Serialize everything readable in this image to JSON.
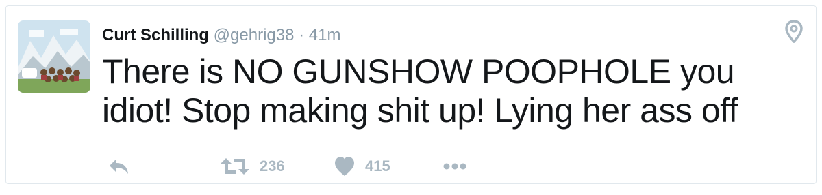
{
  "tweet": {
    "author_name": "Curt Schilling",
    "handle": "@gehrig38",
    "separator": "·",
    "time": "41m",
    "text": "There is NO GUNSHOW POOPHOLE you idiot! Stop making shit up! Lying her ass off"
  },
  "actions": {
    "reply_icon": "reply-icon",
    "retweet_icon": "retweet-icon",
    "retweet_count": "236",
    "like_icon": "heart-icon",
    "like_count": "415",
    "more_icon": "more-dots-icon"
  },
  "icons": {
    "location": "location-pin-icon"
  },
  "colors": {
    "text": "#14171a",
    "muted": "#8899a6",
    "action": "#aab8c2",
    "border": "#e1e8ed"
  }
}
